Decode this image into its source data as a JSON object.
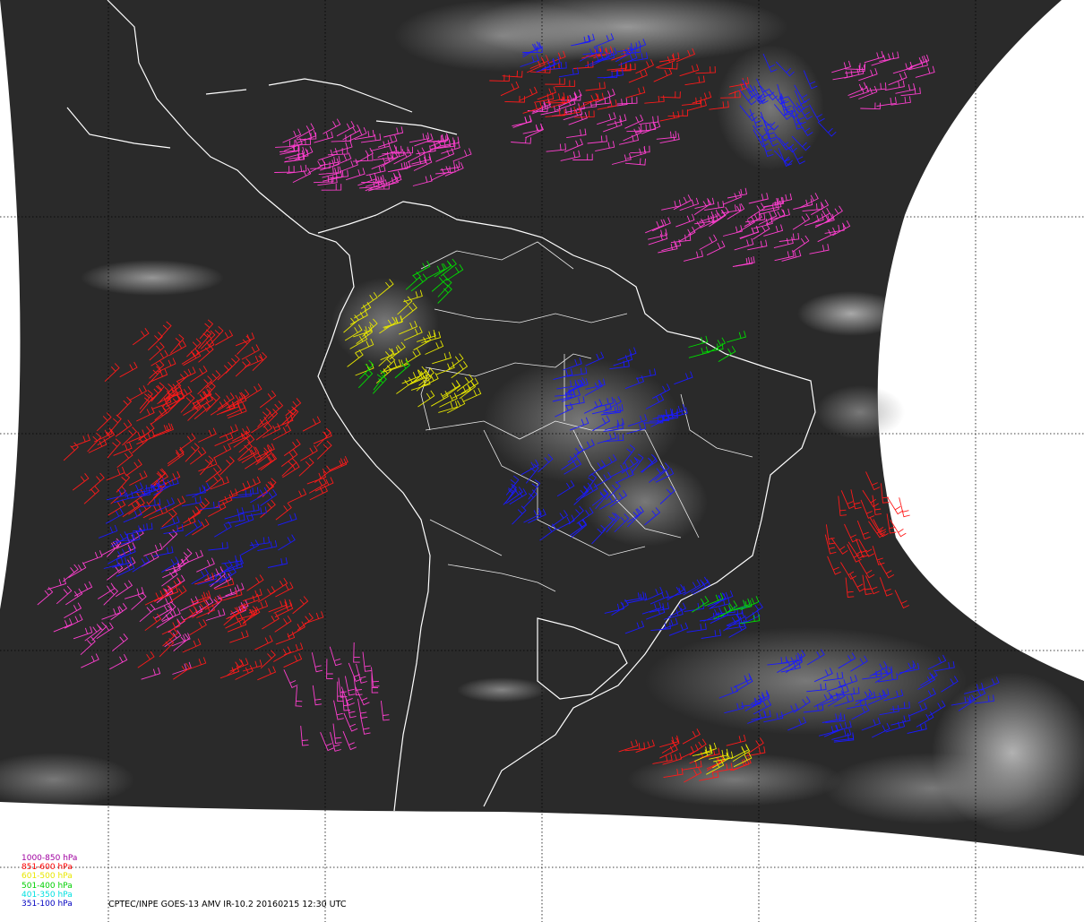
{
  "legend": [
    {
      "label": "1000-850 hPa",
      "color": "#a000a0"
    },
    {
      "label": "851-600 hPa",
      "color": "#ff0000"
    },
    {
      "label": "601-500 hPa",
      "color": "#e8e800"
    },
    {
      "label": "501-400 hPa",
      "color": "#00d000"
    },
    {
      "label": "401-350 hPa",
      "color": "#00e0e0"
    },
    {
      "label": "351-100 hPa",
      "color": "#0000c0"
    }
  ],
  "caption": "CPTEC/INPE GOES-13 AMV IR-10.2 20160215 12:30 UTC",
  "vector_colors": {
    "low_cloud_magenta": "#ff3fd0",
    "red": "#ff1a1a",
    "yellow": "#e8e800",
    "green": "#00dd00",
    "cyan": "#00dddd",
    "blue": "#1a1aff"
  }
}
